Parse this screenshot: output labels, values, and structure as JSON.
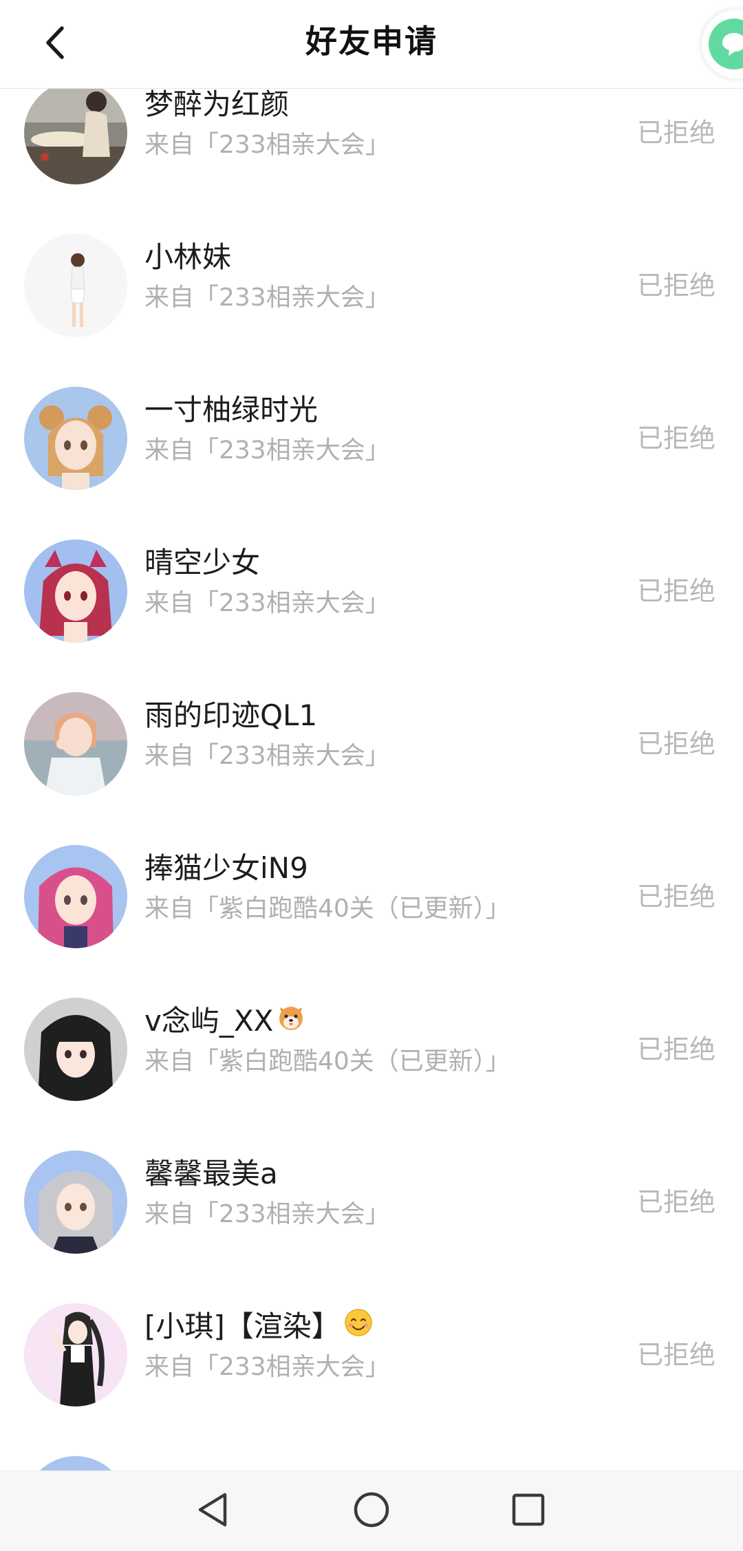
{
  "header": {
    "title": "好友申请",
    "back_icon": "chevron-left-icon",
    "float_icon": "chat-bubble-icon",
    "accent": "#62d9a0"
  },
  "requests": [
    {
      "nickname": "梦醉为红颜",
      "source": "来自「233相亲大会」",
      "status": "已拒绝"
    },
    {
      "nickname": "小林妹",
      "source": "来自「233相亲大会」",
      "status": "已拒绝"
    },
    {
      "nickname": "一寸柚绿时光",
      "source": "来自「233相亲大会」",
      "status": "已拒绝"
    },
    {
      "nickname": "晴空少女",
      "source": "来自「233相亲大会」",
      "status": "已拒绝"
    },
    {
      "nickname": "雨的印迹QL1",
      "source": "来自「233相亲大会」",
      "status": "已拒绝"
    },
    {
      "nickname": "捧猫少女iN9",
      "source": "来自「紫白跑酷40关（已更新）」",
      "status": "已拒绝"
    },
    {
      "nickname": "v念屿_XX",
      "source": "来自「紫白跑酷40关（已更新）」",
      "status": "已拒绝",
      "emoji": "dog-face-emoji"
    },
    {
      "nickname": "馨馨最美a",
      "source": "来自「233相亲大会」",
      "status": "已拒绝"
    },
    {
      "nickname": "[小琪]【渲染】",
      "source": "来自「233相亲大会」",
      "status": "已拒绝",
      "emoji": "smiling-face-emoji"
    },
    {
      "nickname": "",
      "source": "",
      "status": ""
    }
  ],
  "navbar": {
    "back_icon": "triangle-back-icon",
    "home_icon": "circle-home-icon",
    "recent_icon": "square-recent-icon"
  },
  "colors": {
    "status_text": "#b8b8b8",
    "source_text": "#b0b0b0",
    "nickname_text": "#1c1c1c"
  }
}
